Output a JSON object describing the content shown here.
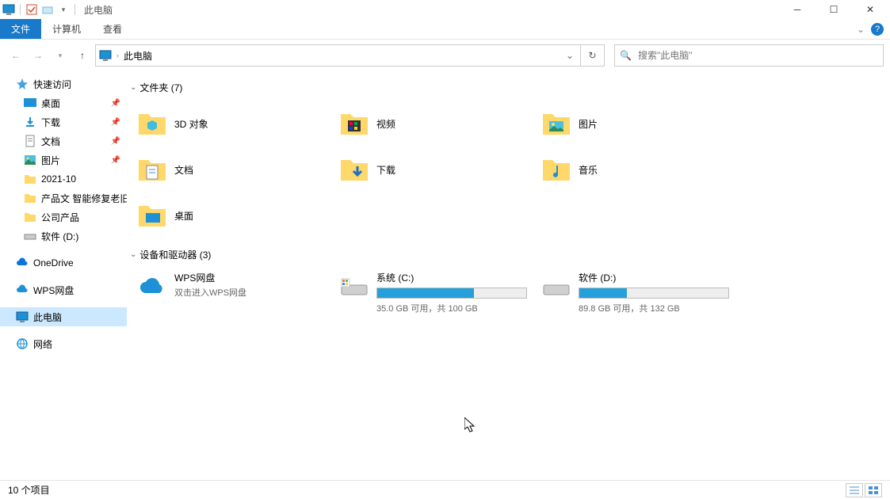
{
  "title": "此电脑",
  "ribbon": {
    "file": "文件",
    "computer": "计算机",
    "view": "查看"
  },
  "address": {
    "text": "此电脑"
  },
  "search": {
    "placeholder": "搜索\"此电脑\""
  },
  "sidebar": {
    "quickaccess": "快速访问",
    "desktop": "桌面",
    "downloads": "下载",
    "documents": "文档",
    "pictures": "图片",
    "f1": "2021-10",
    "f2": "产品文 智能修复老旧",
    "f3": "公司产品",
    "f4": "软件 (D:)",
    "onedrive": "OneDrive",
    "wps": "WPS网盘",
    "thispc": "此电脑",
    "network": "网络"
  },
  "groups": {
    "folders": {
      "label": "文件夹 (7)"
    },
    "drives": {
      "label": "设备和驱动器 (3)"
    }
  },
  "folders": [
    {
      "name": "3D 对象"
    },
    {
      "name": "视频"
    },
    {
      "name": "图片"
    },
    {
      "name": "文档"
    },
    {
      "name": "下载"
    },
    {
      "name": "音乐"
    },
    {
      "name": "桌面"
    }
  ],
  "drives": {
    "wps": {
      "name": "WPS网盘",
      "sub": "双击进入WPS网盘"
    },
    "c": {
      "name": "系统 (C:)",
      "sub": "35.0 GB 可用，共 100 GB",
      "pct": 65
    },
    "d": {
      "name": "软件 (D:)",
      "sub": "89.8 GB 可用，共 132 GB",
      "pct": 32
    }
  },
  "status": "10 个项目"
}
